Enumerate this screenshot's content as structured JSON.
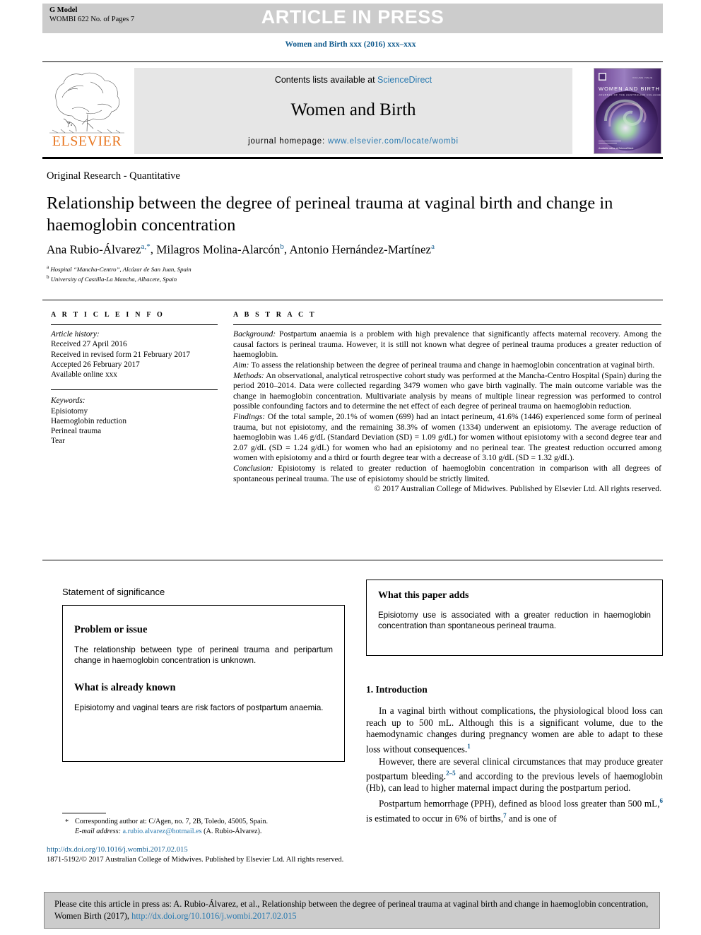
{
  "banner": {
    "gmodel_line1": "G Model",
    "gmodel_line2": "WOMBI 622 No. of Pages 7",
    "press_text": "ARTICLE IN PRESS",
    "banner_color": "#cccccc"
  },
  "journal_ref": "Women and Birth xxx (2016) xxx–xxx",
  "masthead": {
    "contents_prefix": "Contents lists available at ",
    "contents_link": "ScienceDirect",
    "journal_title": "Women and Birth",
    "homepage_prefix": "journal homepage: ",
    "homepage_link": "www.elsevier.com/locate/wombi",
    "publisher_wordmark": "ELSEVIER",
    "publisher_color": "#e87722",
    "link_color": "#2a7ab0",
    "cover_title": "WOMEN AND BIRTH",
    "cover_subtitle": "JOURNAL OF THE AUSTRALIAN COLLEGE OF MIDWIVES"
  },
  "article": {
    "category": "Original Research - Quantitative",
    "title": "Relationship between the degree of perineal trauma at vaginal birth and change in haemoglobin concentration",
    "authors_html": "Ana Rubio-Álvarez, Milagros Molina-Alarcón, Antonio Hernández-Martínez",
    "author1": "Ana Rubio-Álvarez",
    "author1_sup": "a,*",
    "author2": "Milagros Molina-Alarcón",
    "author2_sup": "b",
    "author3": "Antonio Hernández-Martínez",
    "author3_sup": "a",
    "affil_a_sup": "a",
    "affil_a": "Hospital “Mancha-Centro”, Alcázar de San Juan, Spain",
    "affil_b_sup": "b",
    "affil_b": "University of Castilla-La Mancha, Albacete, Spain"
  },
  "article_info": {
    "heading": "A R T I C L E   I N F O",
    "history_label": "Article history:",
    "history": [
      "Received 27 April 2016",
      "Received in revised form 21 February 2017",
      "Accepted 26 February 2017",
      "Available online xxx"
    ],
    "keywords_label": "Keywords:",
    "keywords": [
      "Episiotomy",
      "Haemoglobin reduction",
      "Perineal trauma",
      "Tear"
    ]
  },
  "abstract": {
    "heading": "A B S T R A C T",
    "background_label": "Background:",
    "background": " Postpartum anaemia is a problem with high prevalence that significantly affects maternal recovery. Among the causal factors is perineal trauma. However, it is still not known what degree of perineal trauma produces a greater reduction of haemoglobin.",
    "aim_label": "Aim:",
    "aim": " To assess the relationship between the degree of perineal trauma and change in haemoglobin concentration at vaginal birth.",
    "methods_label": "Methods:",
    "methods": " An observational, analytical retrospective cohort study was performed at the Mancha-Centro Hospital (Spain) during the period 2010–2014. Data were collected regarding 3479 women who gave birth vaginally. The main outcome variable was the change in haemoglobin concentration. Multivariate analysis by means of multiple linear regression was performed to control possible confounding factors and to determine the net effect of each degree of perineal trauma on haemoglobin reduction.",
    "findings_label": "Findings:",
    "findings": " Of the total sample, 20.1% of women (699) had an intact perineum, 41.6% (1446) experienced some form of perineal trauma, but not episiotomy, and the remaining 38.3% of women (1334) underwent an episiotomy. The average reduction of haemoglobin was 1.46 g/dL (Standard Deviation (SD) = 1.09 g/dL) for women without episiotomy with a second degree tear and 2.07 g/dL (SD = 1.24 g/dL) for women who had an episiotomy and no perineal tear. The greatest reduction occurred among women with episiotomy and a third or fourth degree tear with a decrease of 3.10 g/dL (SD = 1.32 g/dL).",
    "conclusion_label": "Conclusion:",
    "conclusion": " Episiotomy is related to greater reduction of haemoglobin concentration in comparison with all degrees of spontaneous perineal trauma. The use of episiotomy should be strictly limited.",
    "copyright": "© 2017 Australian College of Midwives. Published by Elsevier Ltd. All rights reserved."
  },
  "significance": {
    "label": "Statement of significance",
    "problem_heading": "Problem or issue",
    "problem_text": "The relationship between type of perineal trauma and peripartum change in haemoglobin concentration is unknown.",
    "known_heading": "What is already known",
    "known_text": "Episiotomy and vaginal tears are risk factors of postpartum anaemia.",
    "adds_heading": "What this paper adds",
    "adds_text": "Episiotomy use is associated with a greater reduction in haemoglobin concentration than spontaneous perineal trauma."
  },
  "introduction": {
    "heading": "1. Introduction",
    "para1_a": "In a vaginal birth without complications, the physiological blood loss can reach up to 500 mL. Although this is a significant volume, due to the haemodynamic changes during pregnancy women are able to adapt to these loss without consequences.",
    "para1_ref": "1",
    "para2_a": "However, there are several clinical circumstances that may produce greater postpartum bleeding.",
    "para2_ref": "2–5",
    "para2_b": " and according to the previous levels of haemoglobin (Hb), can lead to higher maternal impact during the postpartum period.",
    "para3_a": "Postpartum hemorrhage (PPH), defined as blood loss greater than 500 mL,",
    "para3_ref1": "6",
    "para3_b": " is estimated to occur in 6% of births,",
    "para3_ref2": "7",
    "para3_c": " and is one of"
  },
  "footnotes": {
    "star": "*",
    "corresponding": "Corresponding author at: C/Agen, no. 7, 2B, Toledo, 45005, Spain.",
    "email_label": "E-mail address:",
    "email": "a.rubio.alvarez@hotmail.es",
    "email_owner": " (A. Rubio-Álvarez).",
    "doi": "http://dx.doi.org/10.1016/j.wombi.2017.02.015",
    "rights": "1871-5192/© 2017 Australian College of Midwives. Published by Elsevier Ltd. All rights reserved."
  },
  "cite_bar": {
    "text_before": "Please cite this article in press as: A. Rubio-Álvarez, et al., Relationship between the degree of perineal trauma at vaginal birth and change in haemoglobin concentration, Women Birth (2017), ",
    "link": "http://dx.doi.org/10.1016/j.wombi.2017.02.015",
    "background": "#cccccc"
  }
}
